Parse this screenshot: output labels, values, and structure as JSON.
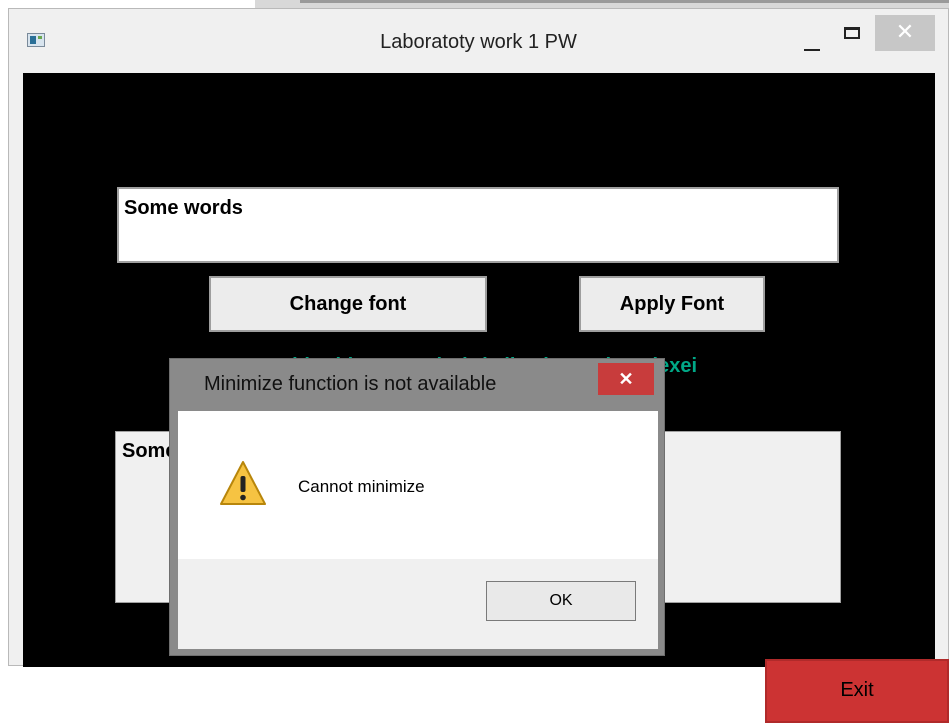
{
  "window": {
    "title": "Laboratoty work 1 PW",
    "close_glyph": "✕"
  },
  "main": {
    "text_field_value": "Some words",
    "change_font_label": "Change font",
    "apply_font_label": "Apply Font",
    "author_label": "Done with Pidgeon and Birds live by Budev Alexei",
    "output_text": "Some words",
    "exit_label": "Exit",
    "label_color": "#00a887"
  },
  "dialog": {
    "title": "Minimize function is not available",
    "message": "Cannot minimize",
    "ok_label": "OK",
    "close_glyph": "✕",
    "icon": "warning-icon"
  }
}
